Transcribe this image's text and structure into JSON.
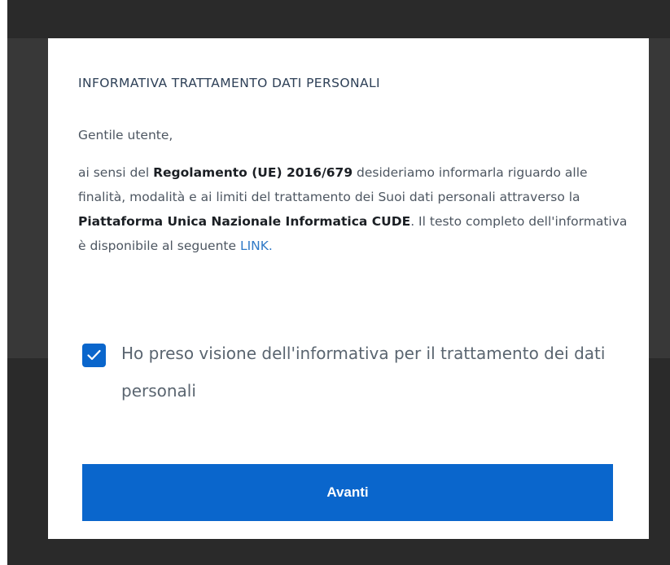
{
  "modal": {
    "title": "INFORMATIVA TRATTAMENTO DATI PERSONALI",
    "greeting": "Gentile utente,",
    "body": {
      "part1": "ai sensi del ",
      "regulation": "Regolamento (UE) 2016/679",
      "part2": " desideriamo informarla riguardo alle finalità, modalità e ai limiti del trattamento dei Suoi dati personali attraverso la ",
      "platform": "Piattaforma Unica Nazionale Informatica CUDE",
      "part3": ". Il testo completo dell'informativa è disponibile al seguente ",
      "link_label": "LINK."
    },
    "consent": {
      "label": "Ho preso visione dell'informativa per il trattamento dei dati personali",
      "checked": true
    },
    "submit_label": "Avanti"
  },
  "colors": {
    "primary": "#0a66cc",
    "link": "#2f79c6",
    "title": "#2e4057",
    "overlay": "#2a2a2a"
  }
}
